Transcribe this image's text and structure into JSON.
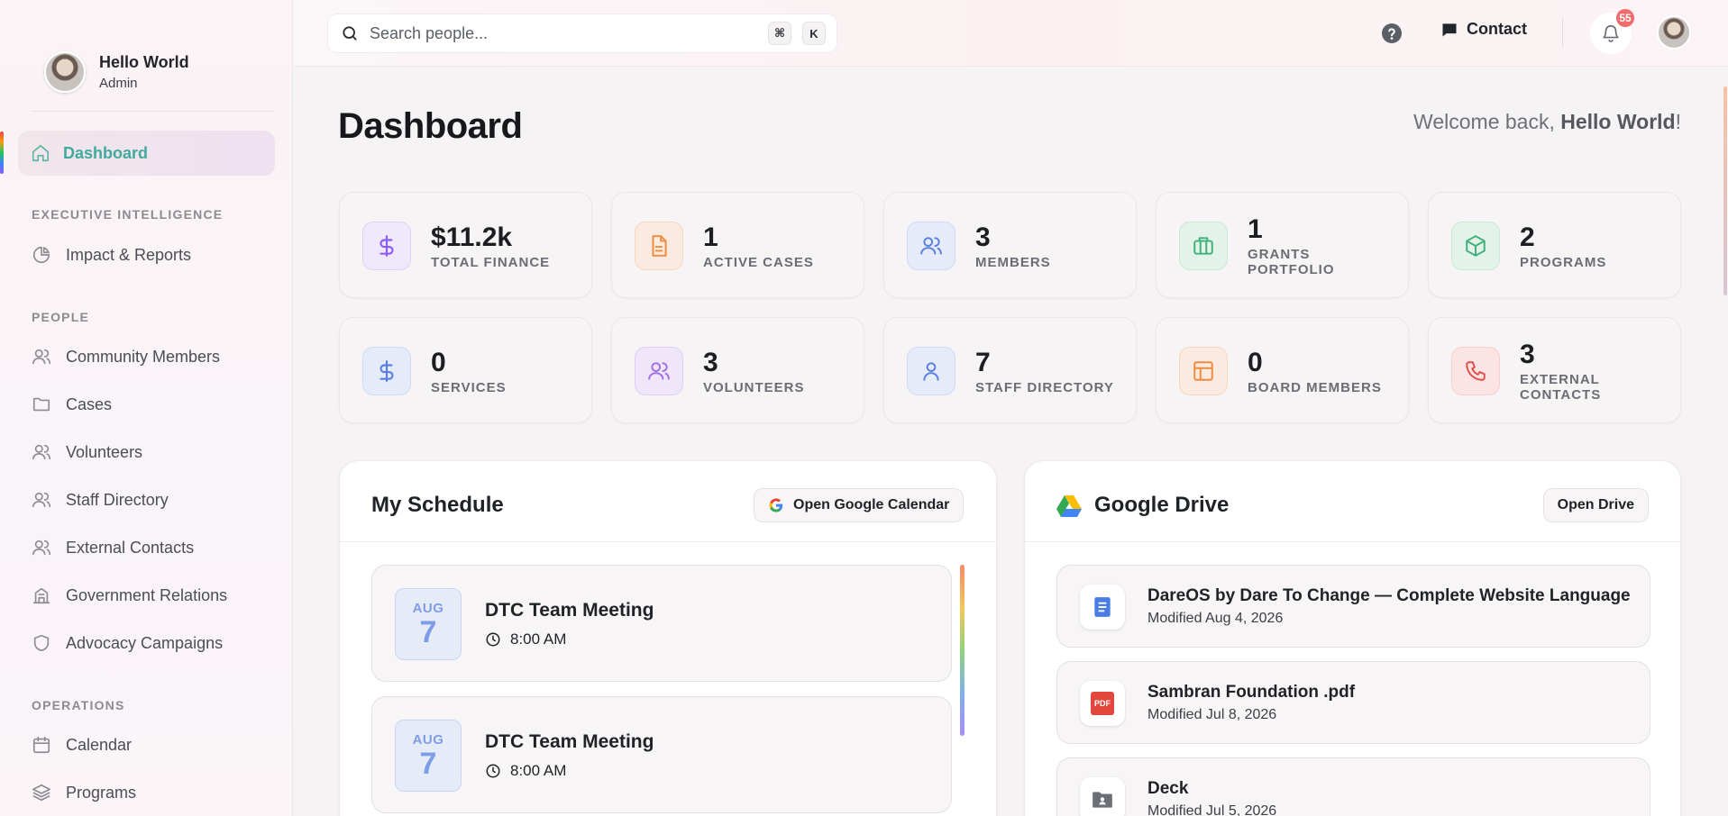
{
  "user": {
    "name": "Hello World",
    "role": "Admin"
  },
  "sidebar": {
    "active_item": "Dashboard",
    "sections": [
      {
        "title": "EXECUTIVE INTELLIGENCE",
        "items": [
          "Impact & Reports"
        ]
      },
      {
        "title": "PEOPLE",
        "items": [
          "Community Members",
          "Cases",
          "Volunteers",
          "Staff Directory",
          "External Contacts",
          "Government Relations",
          "Advocacy Campaigns"
        ]
      },
      {
        "title": "OPERATIONS",
        "items": [
          "Calendar",
          "Programs"
        ]
      }
    ]
  },
  "topbar": {
    "search_placeholder": "Search people...",
    "shortcut_cmd": "⌘",
    "shortcut_key": "K",
    "contact_label": "Contact",
    "notification_count": "55"
  },
  "page": {
    "title": "Dashboard",
    "welcome_prefix": "Welcome back, ",
    "welcome_name": "Hello World",
    "welcome_suffix": "!"
  },
  "stats": [
    {
      "value": "$11.2k",
      "label": "TOTAL FINANCE",
      "icon": "dollar-icon",
      "color": "#8b5cf6",
      "bg": "#efe9fb"
    },
    {
      "value": "1",
      "label": "ACTIVE CASES",
      "icon": "document-icon",
      "color": "#f08a3c",
      "bg": "#fbeadf"
    },
    {
      "value": "3",
      "label": "MEMBERS",
      "icon": "users-icon",
      "color": "#5b7fe0",
      "bg": "#e6ebfa"
    },
    {
      "value": "1",
      "label": "GRANTS PORTFOLIO",
      "icon": "briefcase-icon",
      "color": "#3fb07a",
      "bg": "#e3f3ea"
    },
    {
      "value": "2",
      "label": "PROGRAMS",
      "icon": "cube-icon",
      "color": "#3fb07a",
      "bg": "#e3f3ea"
    },
    {
      "value": "0",
      "label": "SERVICES",
      "icon": "dollar-icon",
      "color": "#5b7fe0",
      "bg": "#e6ebfa"
    },
    {
      "value": "3",
      "label": "VOLUNTEERS",
      "icon": "users-icon",
      "color": "#a06de6",
      "bg": "#efe6fa"
    },
    {
      "value": "7",
      "label": "STAFF DIRECTORY",
      "icon": "user-icon",
      "color": "#5b7fe0",
      "bg": "#e6ebfa"
    },
    {
      "value": "0",
      "label": "BOARD MEMBERS",
      "icon": "layout-icon",
      "color": "#f08a3c",
      "bg": "#fbeadf"
    },
    {
      "value": "3",
      "label": "EXTERNAL CONTACTS",
      "icon": "phone-icon",
      "color": "#e0504b",
      "bg": "#fbe4e3"
    }
  ],
  "schedule": {
    "title": "My Schedule",
    "button_label": "Open Google Calendar",
    "events": [
      {
        "month": "AUG",
        "day": "7",
        "title": "DTC Team Meeting",
        "time": "8:00 AM"
      },
      {
        "month": "AUG",
        "day": "7",
        "title": "DTC Team Meeting",
        "time": "8:00 AM"
      }
    ]
  },
  "drive": {
    "title": "Google Drive",
    "button_label": "Open Drive",
    "files": [
      {
        "name": "DareOS by Dare To Change — Complete Website Language",
        "modified": "Modified Aug 4, 2026",
        "icon": "google-doc-icon"
      },
      {
        "name": "Sambran Foundation .pdf",
        "modified": "Modified Jul 8, 2026",
        "icon": "pdf-icon",
        "icon_text": "PDF"
      },
      {
        "name": "Deck",
        "modified": "Modified Jul 5, 2026",
        "icon": "shared-folder-icon"
      }
    ]
  }
}
